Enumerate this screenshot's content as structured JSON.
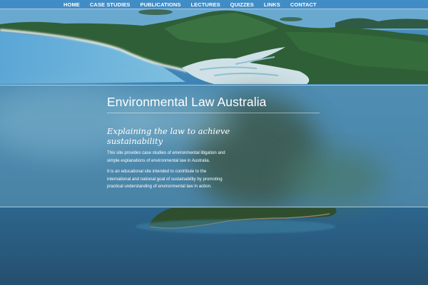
{
  "nav": {
    "items": [
      {
        "label": "HOME"
      },
      {
        "label": "CASE STUDIES"
      },
      {
        "label": "PUBLICATIONS"
      },
      {
        "label": "LECTURES"
      },
      {
        "label": "QUIZZES"
      },
      {
        "label": "LINKS"
      },
      {
        "label": "CONTACT"
      }
    ]
  },
  "hero": {
    "title": "Environmental Law Australia",
    "tagline": "Explaining the law to achieve sustainability",
    "paragraphs": [
      "This site provides case studies of environmental litigation and simple explanations of environmental law in Australia.",
      "It is an educational site intended to contribute to the international and national goal of sustainability by promoting practical understanding of environmental law in action."
    ]
  },
  "colors": {
    "nav_bg": "#408cc6",
    "sea": "#2f6f9c",
    "text": "#ffffff"
  }
}
